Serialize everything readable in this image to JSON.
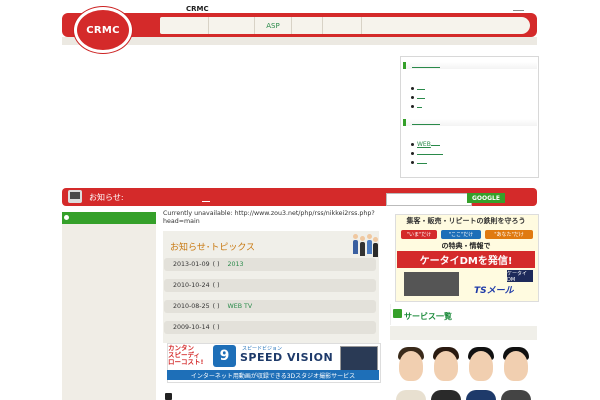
{
  "header": {
    "site_name": "CRMC",
    "logo_text": "CRMC",
    "nav": [
      "",
      "",
      "ASP",
      "",
      ""
    ],
    "brand_color": "#d42a2a",
    "accent_color": "#35a02a"
  },
  "sidebar": {
    "sections": [
      {
        "items": [
          "",
          "",
          ""
        ]
      },
      {
        "items": [
          "WEB",
          "",
          ""
        ]
      }
    ]
  },
  "news_bar": {
    "title": "お知らせ:",
    "search": {
      "value": "",
      "button": "GOOGLE"
    }
  },
  "main": {
    "feed_error": "Currently unavailable: http://www.zou3.net/php/rss/nikkei2rss.php?head=main",
    "topics_title": "お知らせ･トピックス",
    "topics": [
      {
        "date": "2013-01-09",
        "paren": "( )",
        "link": "2013"
      },
      {
        "date": "2010-10-24",
        "paren": "( )",
        "link": ""
      },
      {
        "date": "2010-08-25",
        "paren": "( )",
        "link": "WEB TV"
      },
      {
        "date": "2009-10-14",
        "paren": "( )",
        "link": ""
      }
    ],
    "speedvision": {
      "left_text": [
        "カンタン",
        "スピーディ",
        "ローコスト!"
      ],
      "sub": "スピードビジョン",
      "name": "SPEED VISION",
      "strip": "インターネット用動画が収録できる3Dスタジオ撮影サービス"
    }
  },
  "right": {
    "dm_banner": {
      "top": "集客・販売・リピートの鉄則を守ろう",
      "tags": [
        "\"いま\"だけ",
        "\"ここ\"だけ",
        "\"あなた\"だけ"
      ],
      "mid": "の特典・情報で",
      "headline": "ケータイDMを発信!",
      "phone_label": "ケータイDM",
      "brand": "TSメール"
    },
    "services_title": "サービス一覧"
  }
}
